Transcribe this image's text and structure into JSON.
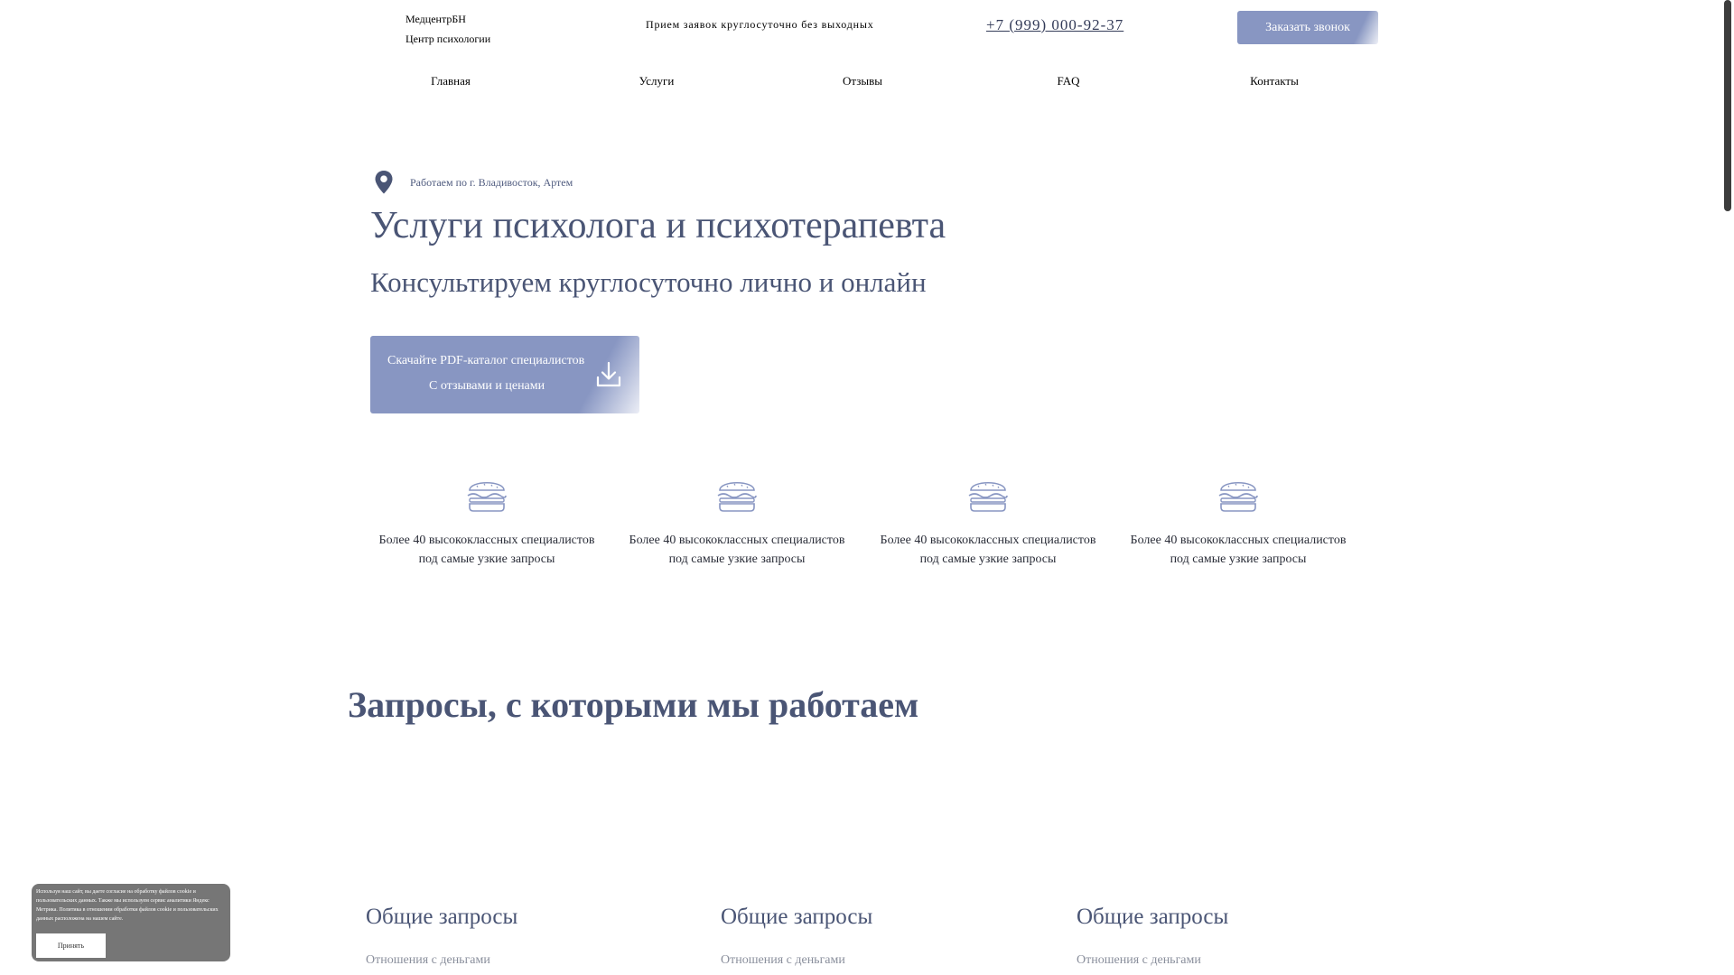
{
  "header": {
    "brand_name": "МедцентрБН",
    "brand_sub": "Центр психологии",
    "tagline": "Прием заявок круглосуточно без выходных",
    "phone": "+7 (999) 000-92-37",
    "callback_label": "Заказать звонок"
  },
  "nav": {
    "items": [
      "Главная",
      "Услуги",
      "Отзывы",
      "FAQ",
      "Контакты"
    ]
  },
  "hero": {
    "location_icon": "map-pin-icon",
    "location_text": "Работаем по г. Владивосток, Артем",
    "title": "Услуги психолога и психотерапевта",
    "subtitle": "Консультируем круглосуточно лично и онлайн",
    "catalog_line1": "Скачайте PDF-каталог специалистов",
    "catalog_line2": "С отзывами и ценами",
    "catalog_icon": "download-icon"
  },
  "features": [
    {
      "icon": "burger-icon",
      "line1": "Более 40 высококлассных специалистов",
      "line2": "под самые узкие запросы"
    },
    {
      "icon": "burger-icon",
      "line1": "Более 40 высококлассных специалистов",
      "line2": "под самые узкие запросы"
    },
    {
      "icon": "burger-icon",
      "line1": "Более 40 высококлассных специалистов",
      "line2": "под самые узкие запросы"
    },
    {
      "icon": "burger-icon",
      "line1": "Более 40 высококлассных специалистов",
      "line2": "под самые узкие запросы"
    }
  ],
  "requests": {
    "title": "Запросы, с которыми мы работаем",
    "columns": [
      {
        "heading": "Общие запросы",
        "item": "Отношения с деньгами"
      },
      {
        "heading": "Общие запросы",
        "item": "Отношения с деньгами"
      },
      {
        "heading": "Общие запросы",
        "item": "Отношения с деньгами"
      }
    ]
  },
  "cookie": {
    "text": "Используя наш сайт, вы даете согласие на обработку файлов cookie и пользовательских данных. Также мы используем сервис аналитики Яндекс Метрика. Политика в отношении обработки файлов cookie и пользовательских данных расположена на нашем сайте.",
    "accept_label": "Принять"
  },
  "colors": {
    "accent": "#8896c2",
    "heading": "#4a5575",
    "cookie_bg": "#767676"
  }
}
